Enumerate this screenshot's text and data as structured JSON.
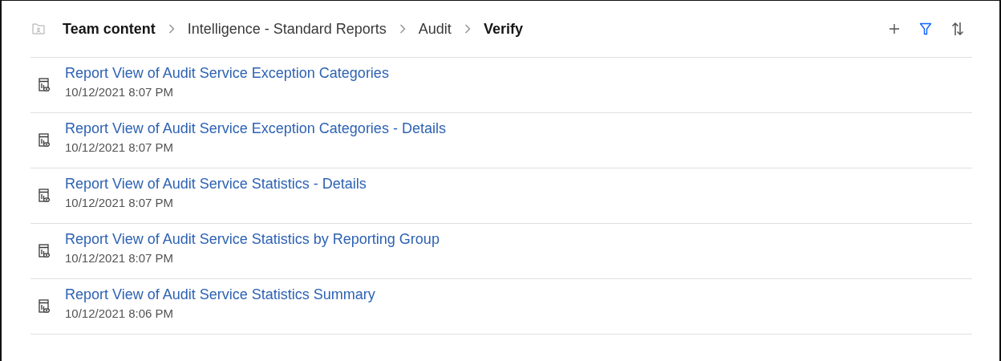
{
  "breadcrumbs": [
    "Team content",
    "Intelligence - Standard Reports",
    "Audit",
    "Verify"
  ],
  "reports": [
    {
      "title": "Report View of Audit Service Exception Categories",
      "modified": "10/12/2021 8:07 PM"
    },
    {
      "title": "Report View of Audit Service Exception Categories - Details",
      "modified": "10/12/2021 8:07 PM"
    },
    {
      "title": "Report View of Audit Service Statistics - Details",
      "modified": "10/12/2021 8:07 PM"
    },
    {
      "title": "Report View of Audit Service Statistics by Reporting Group",
      "modified": "10/12/2021 8:07 PM"
    },
    {
      "title": "Report View of Audit Service Statistics Summary",
      "modified": "10/12/2021 8:06 PM"
    }
  ]
}
